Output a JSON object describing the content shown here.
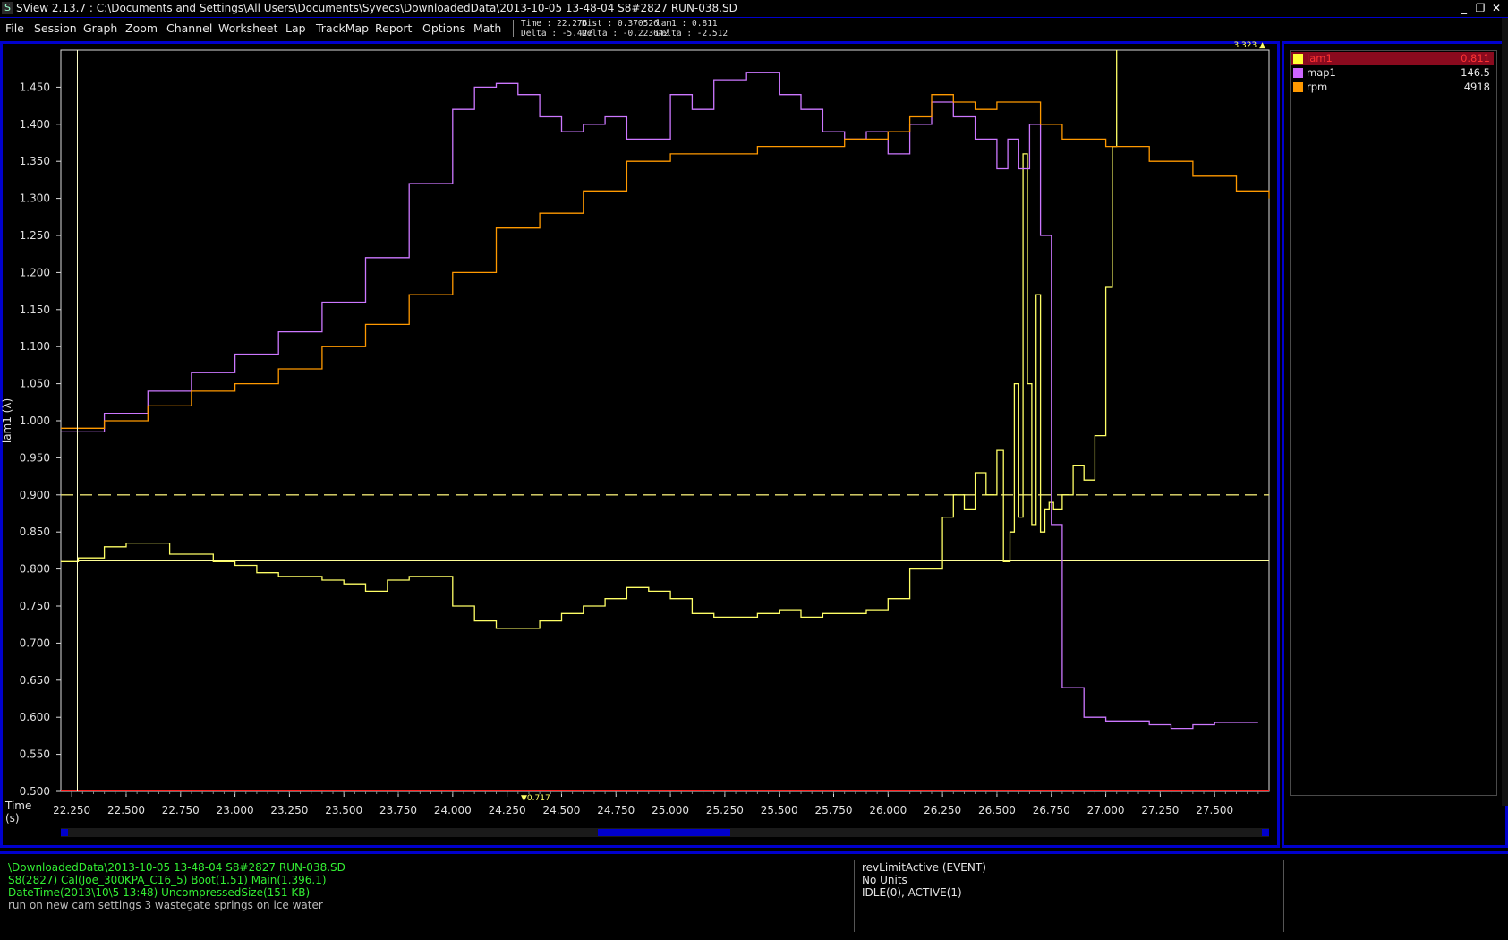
{
  "window": {
    "title": "SView 2.13.7  :  C:\\Documents and Settings\\All Users\\Documents\\Syvecs\\DownloadedData\\2013-10-05 13-48-04 S8#2827 RUN-038.SD",
    "icon": "sview-logo-icon",
    "minimize": "_",
    "restore": "❐",
    "close": "✕"
  },
  "menu": [
    "File",
    "Session",
    "Graph",
    "Zoom",
    "Channel",
    "Worksheet",
    "Lap",
    "TrackMap",
    "Report",
    "Options",
    "Math"
  ],
  "readouts": {
    "time": "Time : 22.276",
    "time_delta": "Delta : -5.427",
    "dist": "Dist : 0.370526",
    "dist_delta": "Delta : -0.223642",
    "lam": "lam1 : 0.811",
    "lam_delta": "Delta : -2.512"
  },
  "legend": [
    {
      "name": "lam1",
      "value": "0.811",
      "color": "#ffff33",
      "selected": true
    },
    {
      "name": "map1",
      "value": "146.5",
      "color": "#cc66ff",
      "selected": false
    },
    {
      "name": "rpm",
      "value": "4918",
      "color": "#ff9900",
      "selected": false
    }
  ],
  "chart_data": {
    "type": "line",
    "ylabel": "lam1 (λ)",
    "xlabel": "Time (s)",
    "xlabel_lines": [
      "Time",
      "(s)"
    ],
    "xlim": [
      22.2,
      27.75
    ],
    "ylim": [
      0.5,
      1.5
    ],
    "x_ticks": [
      "22.250",
      "22.500",
      "22.750",
      "23.000",
      "23.250",
      "23.500",
      "23.750",
      "24.000",
      "24.250",
      "24.500",
      "24.750",
      "25.000",
      "25.250",
      "25.500",
      "25.750",
      "26.000",
      "26.250",
      "26.500",
      "26.750",
      "27.000",
      "27.250",
      "27.500"
    ],
    "y_ticks": [
      "0.500",
      "0.550",
      "0.600",
      "0.650",
      "0.700",
      "0.750",
      "0.800",
      "0.850",
      "0.900",
      "0.950",
      "1.000",
      "1.050",
      "1.100",
      "1.150",
      "1.200",
      "1.250",
      "1.300",
      "1.350",
      "1.400",
      "1.450"
    ],
    "top_marker": "3.323",
    "bottom_marker": "0.717",
    "cursor_x": 22.276,
    "cursor_value": 0.811,
    "target_line": 0.9,
    "series": [
      {
        "name": "lam1",
        "color": "#ffff66",
        "x": [
          22.2,
          22.28,
          22.4,
          22.5,
          22.6,
          22.7,
          22.8,
          22.9,
          23.0,
          23.1,
          23.2,
          23.3,
          23.4,
          23.5,
          23.6,
          23.7,
          23.8,
          23.9,
          24.0,
          24.1,
          24.2,
          24.3,
          24.4,
          24.5,
          24.6,
          24.7,
          24.8,
          24.9,
          25.0,
          25.1,
          25.2,
          25.3,
          25.4,
          25.5,
          25.6,
          25.7,
          25.8,
          25.9,
          26.0,
          26.1,
          26.2,
          26.25,
          26.3,
          26.35,
          26.4,
          26.45,
          26.5,
          26.53,
          26.56,
          26.58,
          26.6,
          26.62,
          26.64,
          26.66,
          26.68,
          26.7,
          26.72,
          26.74,
          26.76,
          26.8,
          26.85,
          26.9,
          26.95,
          27.0,
          27.03,
          27.05
        ],
        "y": [
          0.81,
          0.815,
          0.83,
          0.835,
          0.835,
          0.82,
          0.82,
          0.81,
          0.805,
          0.795,
          0.79,
          0.79,
          0.785,
          0.78,
          0.77,
          0.785,
          0.79,
          0.79,
          0.75,
          0.73,
          0.72,
          0.72,
          0.73,
          0.74,
          0.75,
          0.76,
          0.775,
          0.77,
          0.76,
          0.74,
          0.735,
          0.735,
          0.74,
          0.745,
          0.735,
          0.74,
          0.74,
          0.745,
          0.76,
          0.8,
          0.8,
          0.87,
          0.9,
          0.88,
          0.93,
          0.9,
          0.96,
          0.81,
          0.85,
          1.05,
          0.87,
          1.36,
          1.05,
          0.86,
          1.17,
          0.85,
          0.88,
          0.89,
          0.88,
          0.9,
          0.94,
          0.92,
          0.98,
          1.18,
          1.37,
          1.5
        ]
      },
      {
        "name": "map1",
        "color": "#cc77ff",
        "x": [
          22.2,
          22.4,
          22.6,
          22.8,
          23.0,
          23.2,
          23.4,
          23.6,
          23.8,
          24.0,
          24.1,
          24.2,
          24.3,
          24.4,
          24.5,
          24.6,
          24.7,
          24.8,
          25.0,
          25.1,
          25.2,
          25.35,
          25.5,
          25.6,
          25.7,
          25.8,
          25.9,
          26.0,
          26.1,
          26.2,
          26.3,
          26.4,
          26.5,
          26.55,
          26.6,
          26.65,
          26.7,
          26.75,
          26.8,
          26.9,
          27.0,
          27.1,
          27.2,
          27.3,
          27.4,
          27.5,
          27.6,
          27.7
        ],
        "y": [
          0.985,
          1.01,
          1.04,
          1.065,
          1.09,
          1.12,
          1.16,
          1.22,
          1.32,
          1.42,
          1.45,
          1.455,
          1.44,
          1.41,
          1.39,
          1.4,
          1.41,
          1.38,
          1.44,
          1.42,
          1.46,
          1.47,
          1.44,
          1.42,
          1.39,
          1.38,
          1.39,
          1.36,
          1.4,
          1.43,
          1.41,
          1.38,
          1.34,
          1.38,
          1.34,
          1.4,
          1.25,
          0.86,
          0.64,
          0.6,
          0.595,
          0.595,
          0.59,
          0.585,
          0.59,
          0.593,
          0.593,
          0.593
        ]
      },
      {
        "name": "rpm",
        "color": "#ff9900",
        "x": [
          22.2,
          22.4,
          22.6,
          22.8,
          23.0,
          23.2,
          23.4,
          23.6,
          23.8,
          24.0,
          24.2,
          24.4,
          24.6,
          24.8,
          25.0,
          25.2,
          25.4,
          25.6,
          25.8,
          26.0,
          26.1,
          26.2,
          26.3,
          26.4,
          26.5,
          26.6,
          26.7,
          26.8,
          27.0,
          27.2,
          27.4,
          27.6,
          27.75
        ],
        "y": [
          0.99,
          1.0,
          1.02,
          1.04,
          1.05,
          1.07,
          1.1,
          1.13,
          1.17,
          1.2,
          1.26,
          1.28,
          1.31,
          1.35,
          1.36,
          1.36,
          1.37,
          1.37,
          1.38,
          1.39,
          1.41,
          1.44,
          1.43,
          1.42,
          1.43,
          1.43,
          1.4,
          1.38,
          1.37,
          1.35,
          1.33,
          1.31,
          1.3
        ]
      }
    ]
  },
  "status": {
    "left": [
      "\\DownloadedData\\2013-10-05 13-48-04 S8#2827 RUN-038.SD",
      "S8(2827) Cal(Joe_300KPA_C16_5) Boot(1.51) Main(1.396.1)",
      "DateTime(2013\\10\\5 13:48) UncompressedSize(151 KB)",
      "run on new cam settings 3 wastegate springs on ice water"
    ],
    "right": [
      "revLimitActive (EVENT)",
      "No Units",
      "IDLE(0), ACTIVE(1)"
    ]
  },
  "colors": {
    "frame": "#0000cc",
    "status_green": "#33ee33",
    "legend_selected_bg": "#8a0a1e",
    "legend_selected_text": "#ff3333"
  }
}
